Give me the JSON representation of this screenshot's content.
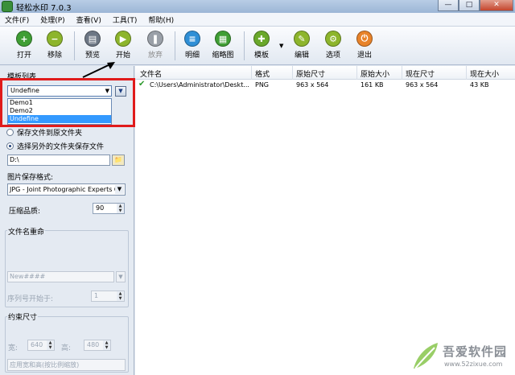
{
  "window": {
    "title": "轻松水印 7.0.3",
    "minimize": "—",
    "maximize": "□",
    "close": "✕"
  },
  "menu": [
    "文件(F)",
    "处理(P)",
    "查看(V)",
    "工具(T)",
    "帮助(H)"
  ],
  "toolbar": {
    "open": "打开",
    "remove": "移除",
    "preview": "预览",
    "start": "开始",
    "abort": "放弃",
    "detail": "明细",
    "thumbnail": "缩略图",
    "template": "模板",
    "edit": "编辑",
    "options": "选项",
    "exit": "退出",
    "template_dropdown": "▼"
  },
  "left": {
    "template_list_label": "模板列表",
    "template_selected": "Undefine",
    "template_options": [
      "Demo1",
      "Demo2",
      "Undefine"
    ],
    "template_btn": "▼",
    "save_original": "保存文件到原文件夹",
    "save_other": "选择另外的文件夹保存文件",
    "save_path": "D:\\",
    "format_label": "图片保存格式:",
    "format_value": "JPG - Joint Photographic Experts G",
    "quality_label": "压缩品质:",
    "quality_value": "90",
    "rename_label": "文件名重命",
    "rename_pattern": "New####",
    "seq_label": "序列号开始于:",
    "seq_value": "1",
    "constraint_label": "约束尺寸",
    "width_label": "宽:",
    "width_value": "640",
    "height_label": "高:",
    "height_value": "480",
    "apply_mode": "应用宽和高(按比例缩放)"
  },
  "grid": {
    "columns": [
      "文件名",
      "格式",
      "原始尺寸",
      "原始大小",
      "现在尺寸",
      "现在大小"
    ],
    "rows": [
      {
        "file": "C:\\Users\\Administrator\\Deskt...",
        "format": "PNG",
        "orig_dim": "963 x 564",
        "orig_size": "161 KB",
        "now_dim": "963 x 564",
        "now_size": "43 KB"
      }
    ]
  },
  "watermark": {
    "brand": "吾爱软件园",
    "url": "www.52zixue.com"
  },
  "colors": {
    "accent": "#e01b1b",
    "selection": "#3399ff"
  }
}
